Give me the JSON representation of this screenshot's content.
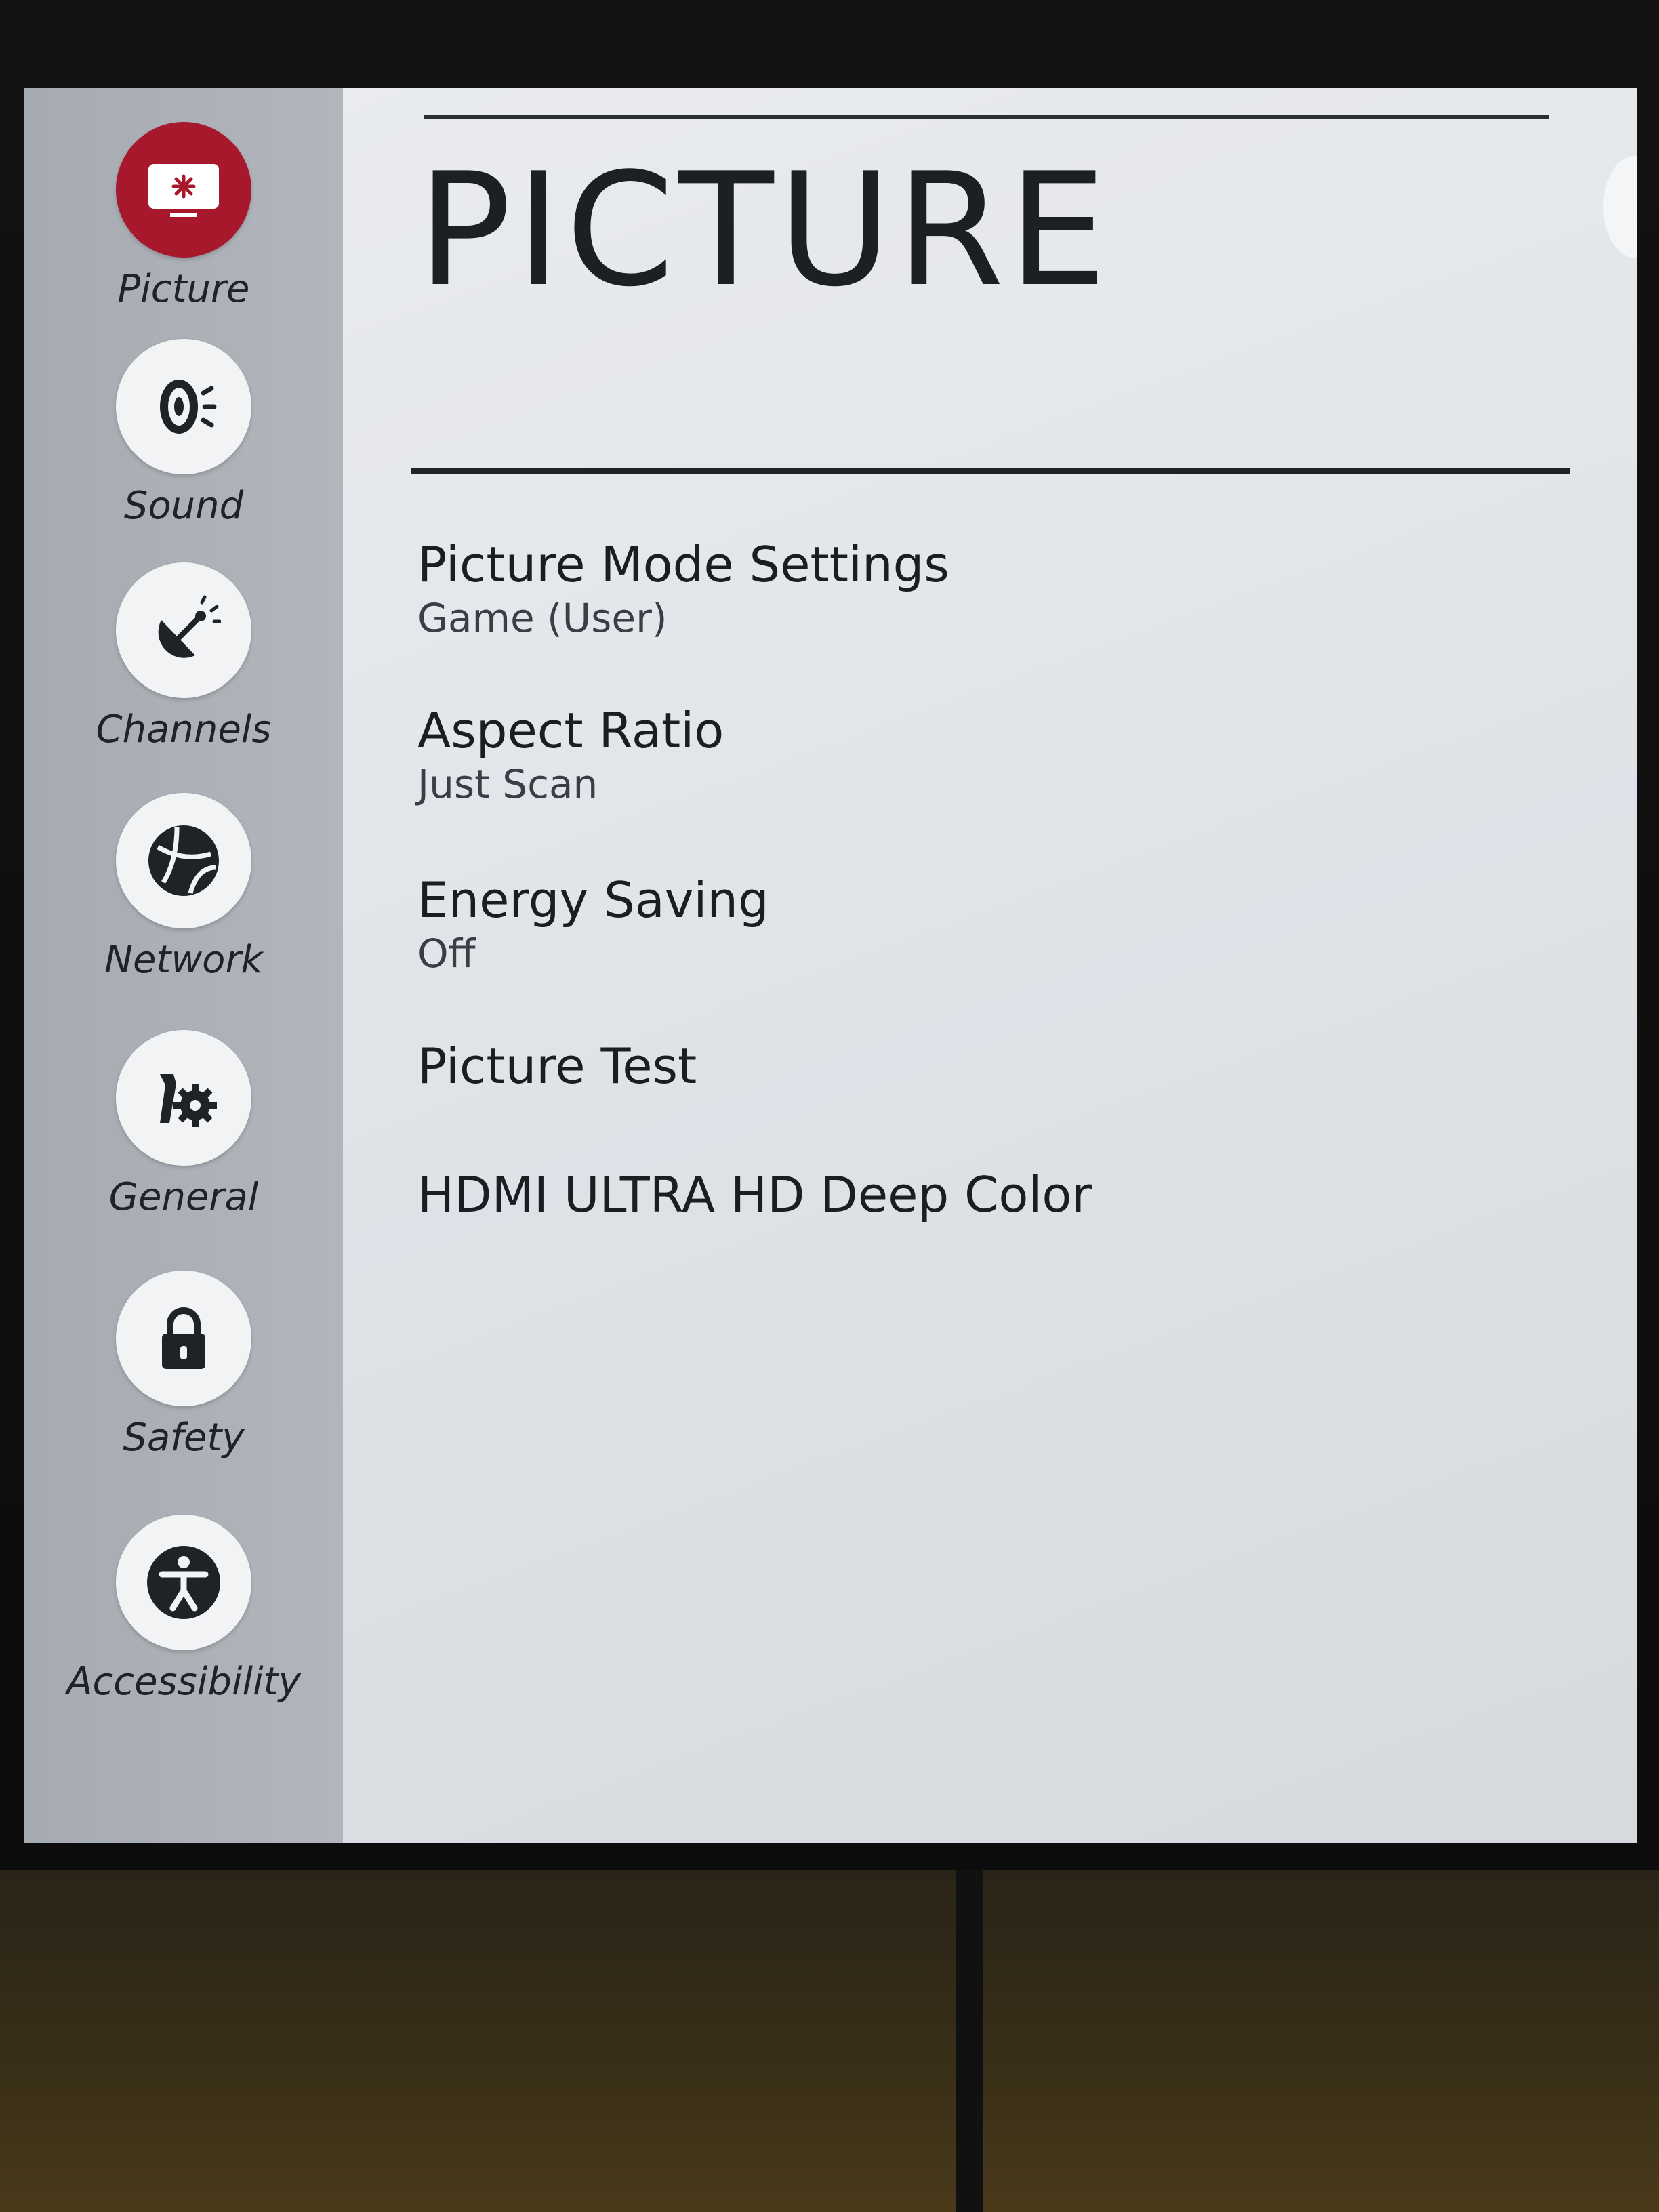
{
  "menu": {
    "title": "PICTURE",
    "items": [
      {
        "label": "Picture Mode Settings",
        "value": "Game (User)"
      },
      {
        "label": "Aspect Ratio",
        "value": "Just Scan"
      },
      {
        "label": "Energy Saving",
        "value": "Off"
      },
      {
        "label": "Picture Test",
        "value": ""
      },
      {
        "label": "HDMI ULTRA HD Deep Color",
        "value": ""
      }
    ]
  },
  "sidebar": {
    "items": [
      {
        "label": "Picture",
        "icon": "picture-icon",
        "active": true
      },
      {
        "label": "Sound",
        "icon": "sound-icon"
      },
      {
        "label": "Channels",
        "icon": "channels-icon"
      },
      {
        "label": "Network",
        "icon": "network-icon"
      },
      {
        "label": "General",
        "icon": "general-icon"
      },
      {
        "label": "Safety",
        "icon": "safety-icon"
      },
      {
        "label": "Accessibility",
        "icon": "accessibility-icon"
      }
    ]
  },
  "colors": {
    "active_accent": "#a8182c",
    "sidebar_bg": "#a6aab1",
    "content_bg": "#e4e7eb"
  }
}
